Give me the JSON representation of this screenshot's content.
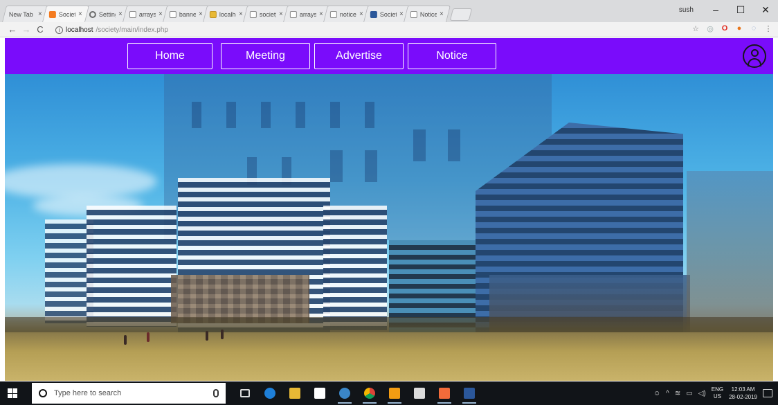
{
  "browser": {
    "tabs": [
      {
        "title": "New Tab",
        "icon": "blank-page-icon",
        "active": false
      },
      {
        "title": "Society",
        "icon": "orange-app-icon",
        "active": true
      },
      {
        "title": "Settings",
        "icon": "gear-icon",
        "active": false
      },
      {
        "title": "arrays",
        "icon": "page-icon",
        "active": false
      },
      {
        "title": "banner",
        "icon": "page-icon",
        "active": false
      },
      {
        "title": "localho",
        "icon": "folder-icon",
        "active": false
      },
      {
        "title": "society",
        "icon": "page-icon",
        "active": false
      },
      {
        "title": "arrays",
        "icon": "page-icon",
        "active": false
      },
      {
        "title": "notice",
        "icon": "page-icon",
        "active": false
      },
      {
        "title": "Society",
        "icon": "w-icon",
        "active": false
      },
      {
        "title": "Notice",
        "icon": "page-icon",
        "active": false
      }
    ],
    "profile_name": "sush",
    "window_controls": {
      "minimize": "–",
      "maximize": "☐",
      "close": "✕"
    },
    "address": {
      "host": "localhost",
      "path": "/society/main/index.php"
    },
    "nav_glyphs": {
      "back": "←",
      "forward": "→",
      "reload": "C",
      "info": "i"
    }
  },
  "site": {
    "nav": {
      "home": "Home",
      "meeting": "Meeting",
      "advertise": "Advertise",
      "notice": "Notice"
    },
    "accent": "#7a0cfb"
  },
  "taskbar": {
    "search_placeholder": "Type here to search",
    "tray": {
      "lang_top": "ENG",
      "lang_bottom": "US",
      "time": "12:03 AM",
      "date": "28-02-2019"
    }
  }
}
